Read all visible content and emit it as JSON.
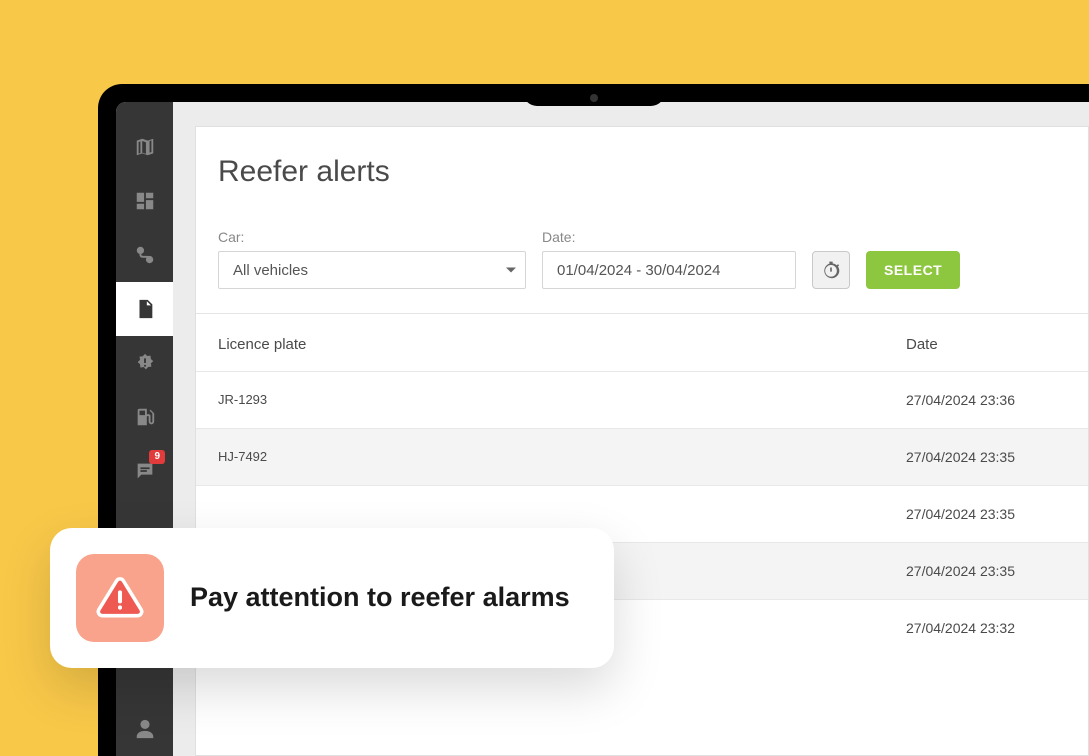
{
  "page_title": "Reefer alerts",
  "filters": {
    "car_label": "Car:",
    "car_value": "All vehicles",
    "date_label": "Date:",
    "date_value": "01/04/2024 - 30/04/2024",
    "select_button": "SELECT"
  },
  "table": {
    "header_plate": "Licence plate",
    "header_date": "Date",
    "rows": [
      {
        "plate": "JR-1293",
        "date": "27/04/2024 23:36"
      },
      {
        "plate": "HJ-7492",
        "date": "27/04/2024 23:35"
      },
      {
        "plate": "",
        "date": "27/04/2024 23:35"
      },
      {
        "plate": "",
        "date": "27/04/2024 23:35"
      },
      {
        "plate": "",
        "date": "27/04/2024 23:32"
      }
    ]
  },
  "sidebar": {
    "badge_count": "9"
  },
  "callout": {
    "text": "Pay attention to reefer alarms"
  }
}
